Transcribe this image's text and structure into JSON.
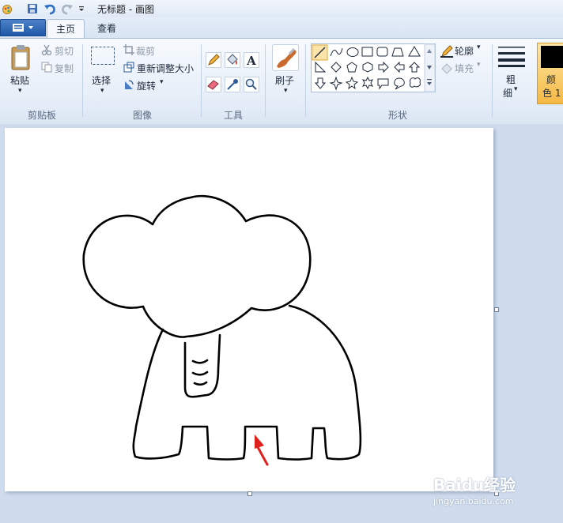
{
  "window": {
    "title": "无标题 - 画图"
  },
  "tabs": [
    {
      "label": "主页"
    },
    {
      "label": "查看"
    }
  ],
  "clipboard": {
    "paste": "粘贴",
    "cut": "剪切",
    "copy": "复制",
    "group": "剪贴板"
  },
  "image": {
    "select": "选择",
    "crop": "裁剪",
    "resize": "重新调整大小",
    "rotate": "旋转",
    "group": "图像"
  },
  "tools": {
    "group": "工具"
  },
  "brushes": {
    "label": "刷子"
  },
  "shapes": {
    "outline": "轮廓",
    "fill": "填充",
    "group": "形状"
  },
  "size": {
    "label1": "粗",
    "label2": "细"
  },
  "colors": {
    "color1a": "颜",
    "color1b": "色 1",
    "primary": "#000000",
    "accent": "#f5b945"
  },
  "watermark": {
    "brand": "Baidu经验",
    "url": "jingyan.baidu.com"
  }
}
